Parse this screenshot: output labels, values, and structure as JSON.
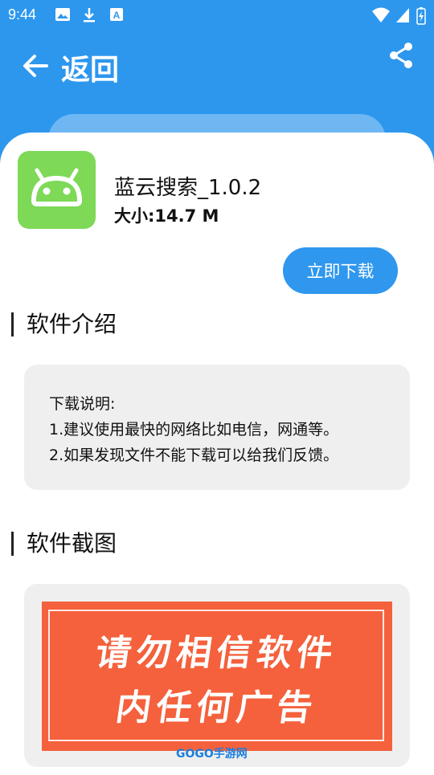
{
  "status_bar": {
    "time": "9:44"
  },
  "app_bar": {
    "title": "返回"
  },
  "app": {
    "name": "蓝云搜索_1.0.2",
    "size": "大小:14.7 M",
    "icon_color": "#7ed957"
  },
  "download_button": {
    "label": "立即下载"
  },
  "intro": {
    "title": "软件介绍",
    "lines": [
      "下载说明:",
      "1.建议使用最快的网络比如电信，网通等。",
      "2.如果发现文件不能下载可以给我们反馈。"
    ]
  },
  "screenshots": {
    "title": "软件截图",
    "banner_lines": [
      "请勿相信软件",
      "内任何广告"
    ],
    "watermark": "GOGO手游网"
  },
  "colors": {
    "primary": "#2d97ee",
    "banner": "#f4613c"
  }
}
